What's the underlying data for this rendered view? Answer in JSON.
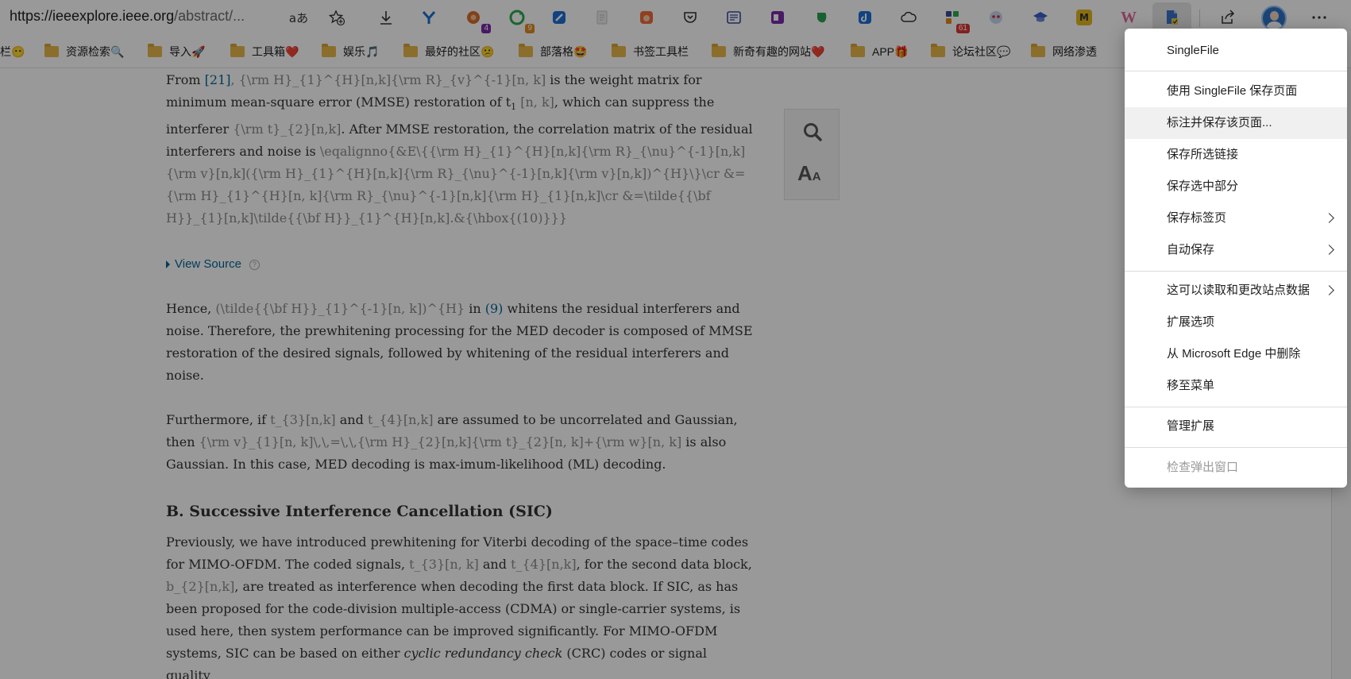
{
  "toolbar": {
    "url_host": "https://ieeexplore.ieee.org",
    "url_rest": "/abstract/...",
    "read_aloud_glyph": "aあ",
    "extensions": [
      {
        "icon": "sticker-icon",
        "badge": "4"
      },
      {
        "icon": "refresh-icon",
        "badge": "9"
      },
      {
        "icon": "notes-icon",
        "badge": "61"
      }
    ],
    "wiki_label": "W",
    "m_label": "M"
  },
  "bookmarks": [
    "栏😶",
    "资源检索🔍",
    "导入🚀",
    "工具箱❤️",
    "娱乐🎵",
    "最好的社区😕",
    "部落格🤩",
    "书签工具栏",
    "新奇有趣的网站❤️",
    "APP🎁",
    "论坛社区💬",
    "网络渗透"
  ],
  "article": {
    "p1": {
      "t1": "From ",
      "ref": "[21]",
      "tex1": ", {\\rm H}_{1}^{H}[n,k]{\\rm R}_{v}^{-1}[n, k]",
      "t2": " is the weight matrix for minimum mean-square error (MMSE) restoration of t",
      "sub": "1",
      "tex2": " [n, k]",
      "t3": ", which can suppress the interferer ",
      "tex3": "{\\rm t}_{2}[n,k]",
      "t4": ". After MMSE restoration, the correlation matrix of the residual interferers and noise is ",
      "tex4": "\\eqalignno{&E\\{{\\rm H}_{1}^{H}[n,k]{\\rm R}_{\\nu}^{-1}[n,k]{\\rm v}[n,k]({\\rm H}_{1}^{H}[n,k]{\\rm R}_{\\nu}^{-1}[n,k]{\\rm v}[n,k])^{H}\\}\\cr &={\\rm H}_{1}^{H}[n, k]{\\rm R}_{\\nu}^{-1}[n,k]{\\rm H}_{1}[n,k]\\cr &=\\tilde{{\\bf H}}_{1}[n,k]\\tilde{{\\bf H}}_{1}^{H}[n,k].&{\\hbox{(10)}}}"
    },
    "view_source": "View Source",
    "help_glyph": "?",
    "p2": {
      "t1": "Hence, ",
      "tex1": "(\\tilde{{\\bf H}}_{1}^{-1}[n, k])^{H}",
      "t2": " in ",
      "ref": "(9)",
      "t3": " whitens the residual interferers and noise. Therefore, the prewhitening processing for the MED decoder is composed of MMSE restoration of the desired signals, followed by whitening of the residual interferers and noise."
    },
    "p3": {
      "t1": "Furthermore, if ",
      "tex1": "t_{3}[n,k]",
      "t2": " and ",
      "tex2": "t_{4}[n,k]",
      "t3": " are assumed to be uncorrelated and Gaussian, then ",
      "tex3": "{\\rm v}_{1}[n, k]\\,\\,=\\,\\,{\\rm H}_{2}[n,k]{\\rm t}_{2}[n, k]+{\\rm w}[n, k]",
      "t4": " is also Gaussian. In this case, MED decoding is max-imum-likelihood (ML) decoding."
    },
    "heading": "B. Successive Interference Cancellation (SIC)",
    "p4": {
      "t1": "Previously, we have introduced prewhitening for Viterbi decoding of the space–time codes for MIMO-OFDM. The coded signals, ",
      "tex1": "t_{3}[n, k]",
      "t2": " and ",
      "tex2": "t_{4}[n,k]",
      "t3": ", for the second data block, ",
      "tex3": "b_{2}[n,k]",
      "t4": ", are treated as interference when decoding the first data block. If SIC, as has been proposed for the code-division multiple-access (CDMA) or single-carrier systems, is used here, then system performance can be improved significantly. For MIMO-OFDM systems, SIC can be based on either ",
      "em": "cyclic redundancy check",
      "t5": " (CRC) codes or signal quality"
    },
    "reader_tools": {
      "aa_big": "A",
      "aa_small": "A"
    }
  },
  "menu": {
    "header": "SingleFile",
    "items": [
      "使用 SingleFile 保存页面",
      "标注并保存该页面...",
      "保存所选链接",
      "保存选中部分",
      "保存标签页",
      "自动保存"
    ],
    "site_data": "这可以读取和更改站点数据",
    "ext_items": [
      "扩展选项",
      "从 Microsoft Edge 中删除",
      "移至菜单"
    ],
    "manage": "管理扩展",
    "inspect": "检查弹出窗口"
  }
}
